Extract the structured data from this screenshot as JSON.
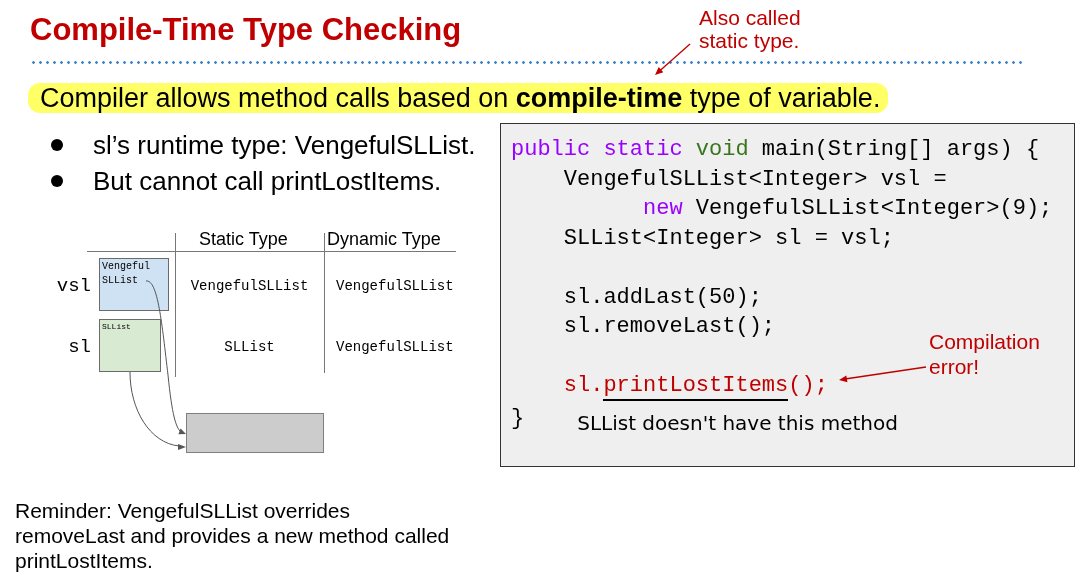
{
  "title": "Compile-Time Type Checking",
  "title_note": "Also called static type.",
  "highlight": "Compiler allows method calls based on **compile-time** type of variable.",
  "bullets": [
    "sl’s runtime type: VengefulSLList.",
    "But cannot call printLostItems."
  ],
  "diagram": {
    "columns": [
      "Static Type",
      "Dynamic Type"
    ],
    "rows": [
      {
        "variable": "vsl",
        "box_label": "Vengeful SLList",
        "color": "#cfe2f3",
        "static_type": "VengefulSLList",
        "dynamic_type": "VengefulSLList"
      },
      {
        "variable": "sl",
        "box_label": "SLList",
        "color": "#d9ead3",
        "static_type": "SLList",
        "dynamic_type": "VengefulSLList"
      }
    ]
  },
  "code": {
    "lines": [
      {
        "kind": "code",
        "tokens": [
          {
            "text": "public static ",
            "kind": "keyword",
            "underlined": false
          },
          {
            "text": "void",
            "kind": "type",
            "underlined": false
          },
          {
            "text": " main(String[] args) {",
            "kind": "plain",
            "underlined": false
          }
        ]
      },
      {
        "kind": "code",
        "tokens": [
          {
            "text": "    VengefulSLList<Integer> vsl =",
            "kind": "plain",
            "underlined": false
          }
        ]
      },
      {
        "kind": "code",
        "tokens": [
          {
            "text": "          new",
            "kind": "keyword",
            "underlined": false
          },
          {
            "text": " VengefulSLList<Integer>(9);",
            "kind": "plain",
            "underlined": false
          }
        ]
      },
      {
        "kind": "code",
        "tokens": [
          {
            "text": "    SLList<Integer> sl = vsl;",
            "kind": "plain",
            "underlined": false
          }
        ]
      },
      {
        "kind": "blank"
      },
      {
        "kind": "code",
        "tokens": [
          {
            "text": "    sl.addLast(50);",
            "kind": "plain",
            "underlined": false
          }
        ]
      },
      {
        "kind": "code",
        "tokens": [
          {
            "text": "    sl.removeLast();",
            "kind": "plain",
            "underlined": false
          }
        ]
      },
      {
        "kind": "blank"
      },
      {
        "kind": "code",
        "tokens": [
          {
            "text": "    sl.",
            "kind": "error",
            "underlined": false
          },
          {
            "text": "printLostItems",
            "kind": "error",
            "underlined": true
          },
          {
            "text": "();",
            "kind": "error",
            "underlined": false
          }
        ]
      },
      {
        "kind": "code",
        "tokens": [
          {
            "text": "}",
            "kind": "plain",
            "underlined": false
          }
        ]
      }
    ],
    "note": "SLList doesn't have this method",
    "error_note": "Compilation error!"
  },
  "reminder": "Reminder: VengefulSLList overrides removeLast and provides a new method called printLostItems."
}
